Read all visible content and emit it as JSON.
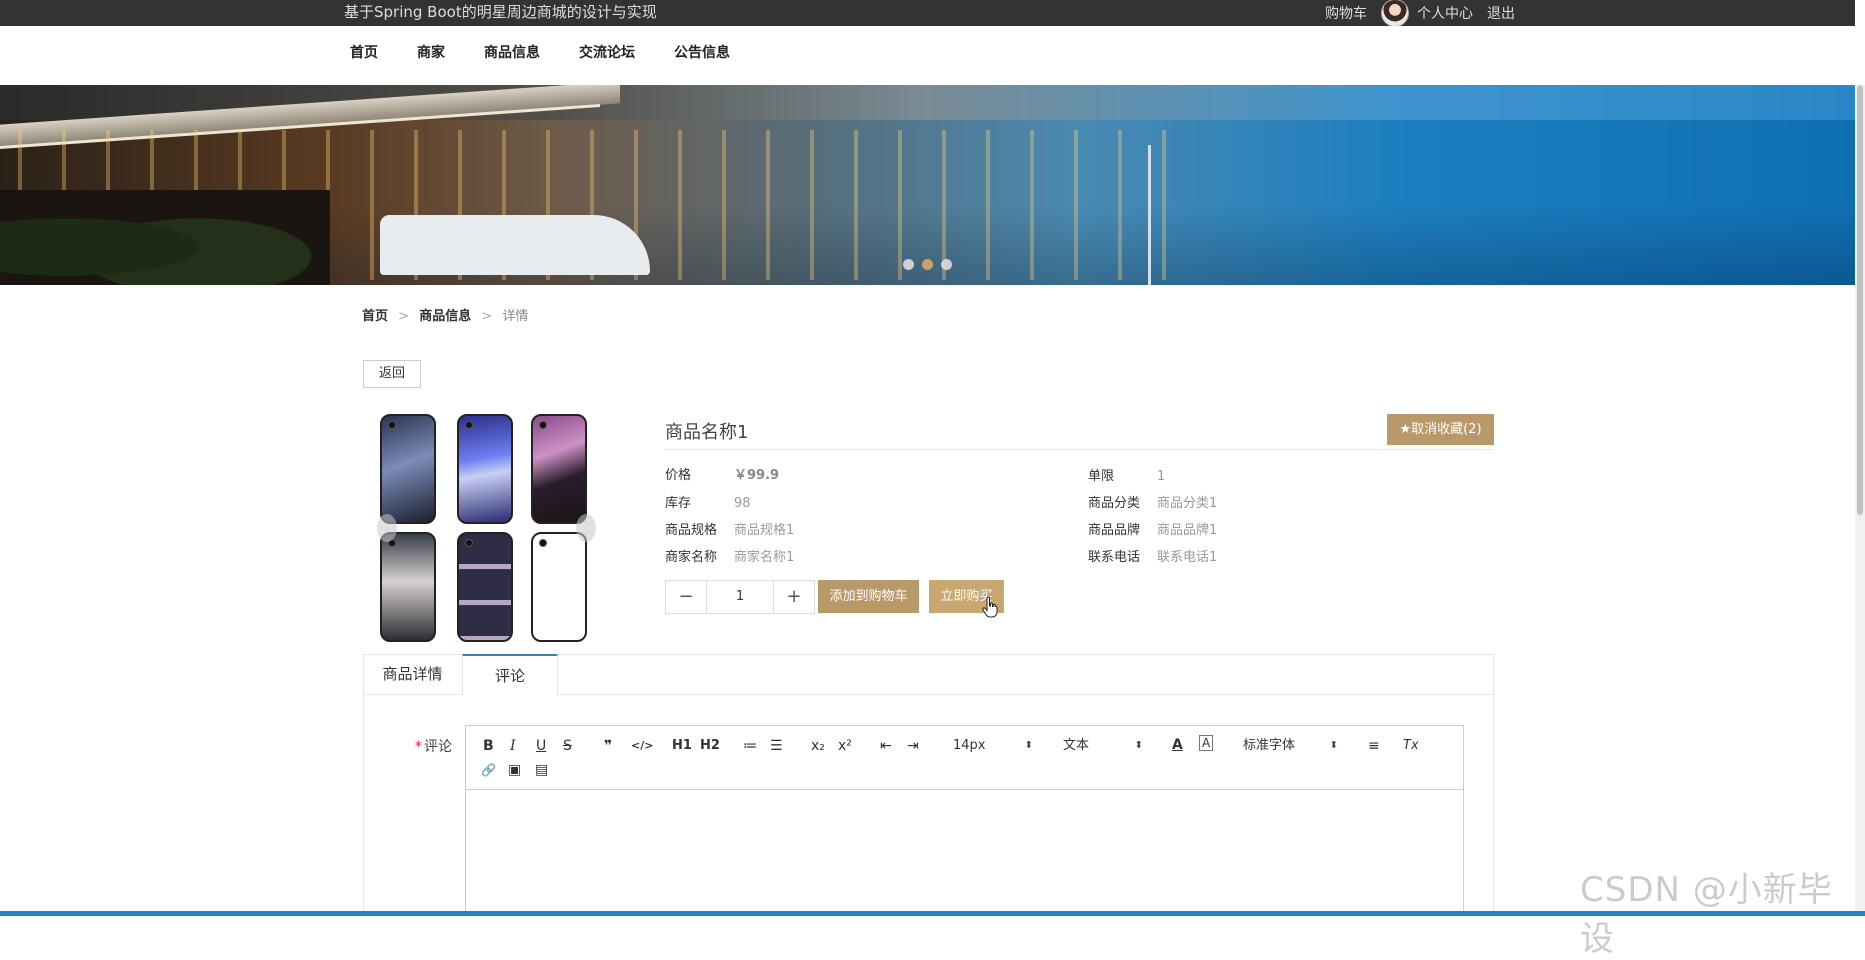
{
  "topbar": {
    "site_title": "基于Spring Boot的明星周边商城的设计与实现",
    "cart": "购物车",
    "profile": "个人中心",
    "logout": "退出"
  },
  "nav": {
    "items": [
      "首页",
      "商家",
      "商品信息",
      "交流论坛",
      "公告信息"
    ]
  },
  "banner": {
    "active_slide": 2,
    "slide_count": 3
  },
  "breadcrumb": {
    "home": "首页",
    "category": "商品信息",
    "current": "详情",
    "sep": ">"
  },
  "back_button": "返回",
  "product": {
    "name": "商品名称1",
    "fav_button": "★取消收藏(2)",
    "attrs_left": [
      {
        "k": "价格",
        "v": "￥99.9"
      },
      {
        "k": "库存",
        "v": "98"
      },
      {
        "k": "商品规格",
        "v": "商品规格1"
      },
      {
        "k": "商家名称",
        "v": "商家名称1"
      }
    ],
    "attrs_right": [
      {
        "k": "单限",
        "v": "1"
      },
      {
        "k": "商品分类",
        "v": "商品分类1"
      },
      {
        "k": "商品品牌",
        "v": "商品品牌1"
      },
      {
        "k": "联系电话",
        "v": "联系电话1"
      }
    ],
    "quantity": "1",
    "minus": "−",
    "plus": "+",
    "add_cart": "添加到购物车",
    "buy_now": "立即购买"
  },
  "tabs": [
    "商品详情",
    "评论"
  ],
  "comment": {
    "label": "评论",
    "required": "*",
    "toolbar": {
      "bold": "B",
      "italic": "I",
      "underline": "U",
      "strike": "S",
      "quote": "❞",
      "code": "</>",
      "h1": "H1",
      "h2": "H2",
      "ol": "≔",
      "ul": "☰",
      "sub": "x₂",
      "sup": "x²",
      "outdent": "⇤",
      "indent": "⇥",
      "size": "14px",
      "format": "文本",
      "color": "A",
      "bg": "A",
      "font": "标准字体",
      "align": "≡",
      "clear": "Tx",
      "link": "🔗",
      "image": "▣",
      "video": "▤"
    }
  },
  "watermark": "CSDN @小新毕设",
  "colors": {
    "accent": "#b9986a",
    "tab_active": "#2b86c8",
    "topbar": "#333333"
  }
}
